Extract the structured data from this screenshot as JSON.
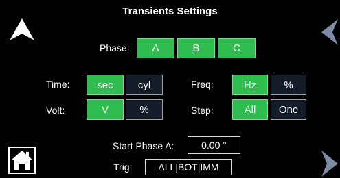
{
  "title": "Transients Settings",
  "icons": {
    "up": "up-arrow-icon",
    "left": "left-arrow-icon",
    "right": "right-arrow-icon",
    "home": "home-icon"
  },
  "phase": {
    "label": "Phase:",
    "options": [
      "A",
      "B",
      "C"
    ]
  },
  "time": {
    "label": "Time:",
    "options": [
      "sec",
      "cyl"
    ],
    "selected": "sec"
  },
  "volt": {
    "label": "Volt:",
    "options": [
      "V",
      "%"
    ],
    "selected": "V"
  },
  "freq": {
    "label": "Freq:",
    "options": [
      "Hz",
      "%"
    ],
    "selected": "Hz"
  },
  "step": {
    "label": "Step:",
    "options": [
      "All",
      "One"
    ],
    "selected": "All"
  },
  "start_phase": {
    "label": "Start Phase A:",
    "value": "0.00 °"
  },
  "trig": {
    "label": "Trig:",
    "value": "ALL|BOT|IMM"
  },
  "colors": {
    "selected": "#2fbd4f",
    "unselected": "#141c2a",
    "arrow": "#ffffff"
  }
}
